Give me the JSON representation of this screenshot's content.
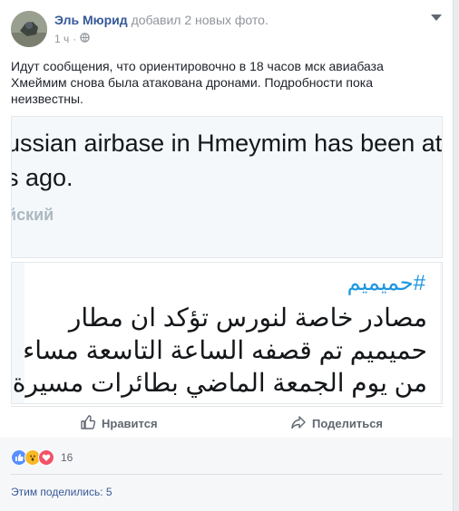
{
  "post": {
    "author": "Эль Мюрид",
    "action": "добавил 2 новых фото.",
    "time": "1 ч",
    "text": "Идут сообщения, что ориентировочно в 18 часов мск авиабаза Хмеймим снова была атакована дронами. Подробности пока неизвестны."
  },
  "photo1": {
    "line1": "ussian airbase in Hmeymim has been atta",
    "line2": "s ago.",
    "line3": "йский"
  },
  "photo2": {
    "hashtag": "#حميميم",
    "lines": [
      "مصادر خاصة لنورس تؤكد ان مطار",
      "حميميم تم قصفه الساعة التاسعة مساء",
      "من يوم الجمعة الماضي بطائرات مسيرة"
    ]
  },
  "actions": {
    "like_label": "Нравится",
    "share_label": "Поделиться"
  },
  "footer": {
    "reaction_count": "16",
    "shares_label": "Этим поделились: 5"
  },
  "colors": {
    "link": "#365899",
    "like_reaction": "#5890ff",
    "love_reaction": "#f25268",
    "wow_reaction": "#f7b928"
  },
  "icons": [
    "avatar",
    "globe-icon",
    "menu-caret-icon",
    "like-icon",
    "share-icon",
    "like-reaction-icon",
    "wow-reaction-icon",
    "love-reaction-icon"
  ]
}
